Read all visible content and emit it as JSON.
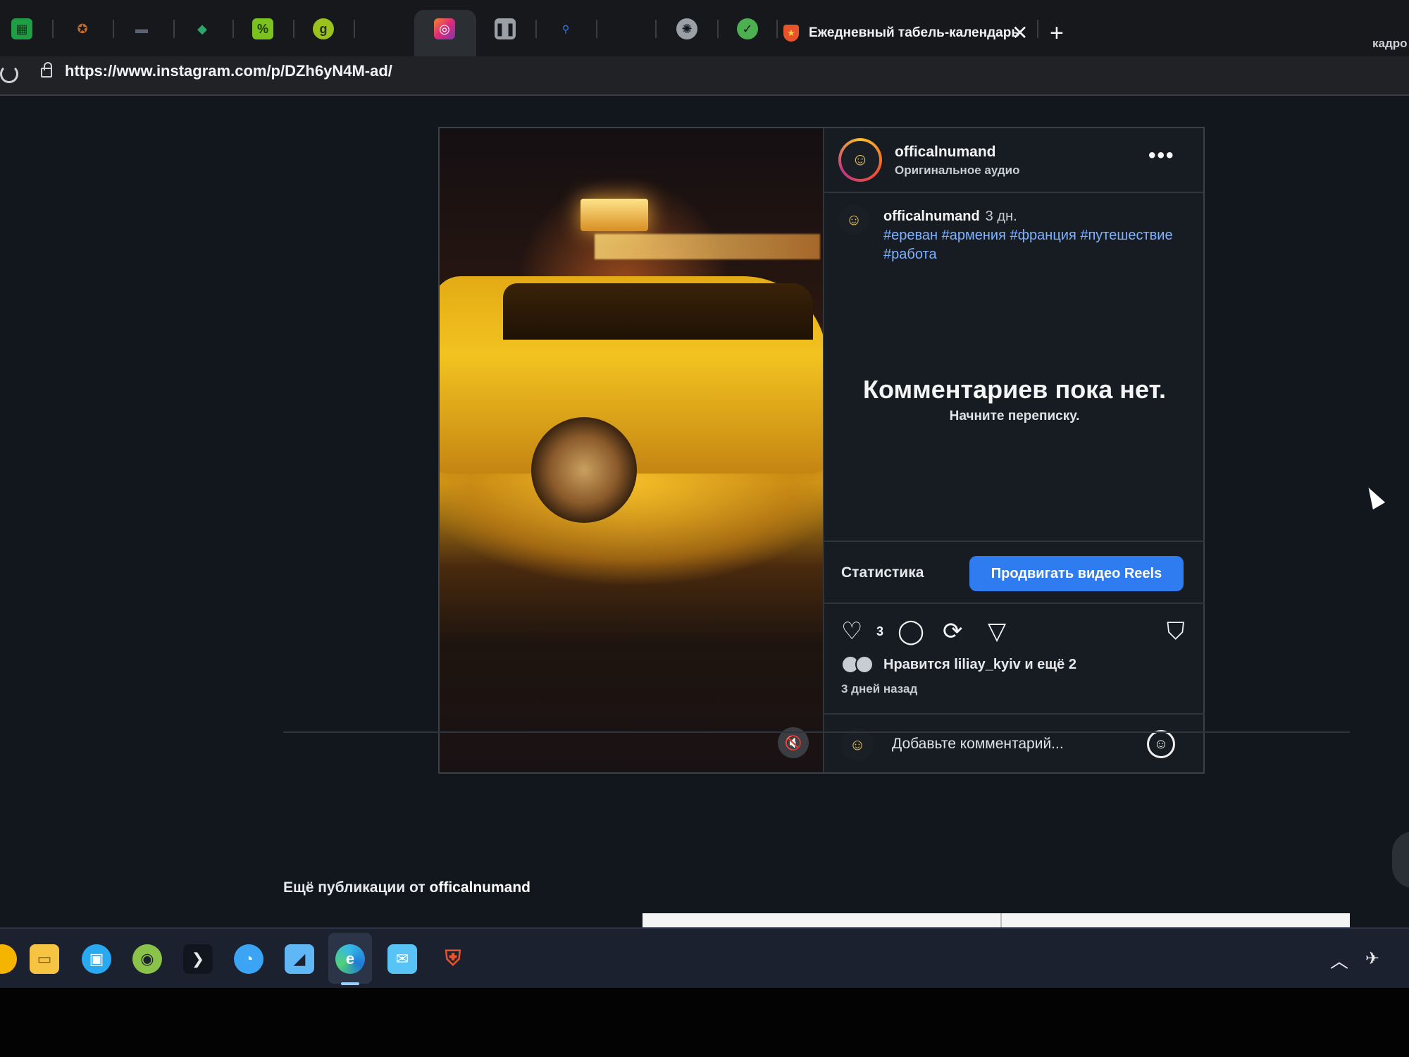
{
  "browser": {
    "tabs": [
      {
        "icon": "green-sheet-icon",
        "color": "#1f9e45"
      },
      {
        "icon": "shield-badge-icon",
        "color": "#c86b28"
      },
      {
        "icon": "folder-icon",
        "color": "#5a6470"
      },
      {
        "icon": "diamond-icon",
        "color": "#2ea56a"
      },
      {
        "icon": "grammarly-like-icon",
        "color": "#7cc21e"
      },
      {
        "icon": "g-circle-icon",
        "color": "#9ac21a"
      },
      {
        "icon": "instagram-icon",
        "color": "#e4405f"
      },
      {
        "icon": "pause-icon",
        "color": "#9aa0a6"
      },
      {
        "icon": "search-icon",
        "color": "#3d7bd8"
      },
      {
        "icon": "blank-tab-icon",
        "color": "#2b2e33"
      },
      {
        "icon": "chatgpt-icon",
        "color": "#9aa0a6"
      },
      {
        "icon": "clock-check-icon",
        "color": "#4caf50"
      }
    ],
    "active_tab_title": "Ежедневный табель-календарь",
    "close_label": "✕",
    "new_tab_label": "+",
    "right_label": "кадро",
    "url": "https://www.instagram.com/p/DZh6yN4M-ad/"
  },
  "post": {
    "username": "officalnumand",
    "audio": "Оригинальное аудио",
    "more_label": "•••",
    "caption_time": "3 дн.",
    "caption_tags": "#ереван #армения #франция #путешествие #работа",
    "empty_title": "Комментариев пока нет.",
    "empty_subtitle": "Начните переписку.",
    "stats_label": "Статистика",
    "promote_label": "Продвигать видео Reels",
    "like_count": "3",
    "likes_text": "Нравится liliay_kyiv и ещё 2",
    "time_ago": "3 дней назад",
    "comment_placeholder": "Добавьте комментарий...",
    "mute_icon": "muted-speaker-icon"
  },
  "footer": {
    "more_posts_prefix": "Ещё публикации от",
    "more_posts_user": "officalnumand"
  },
  "taskbar": {
    "icons": [
      {
        "name": "chrome-icon",
        "color": "#f4b400"
      },
      {
        "name": "file-explorer-icon",
        "color": "#f6c342"
      },
      {
        "name": "store-icon",
        "color": "#29a9f0"
      },
      {
        "name": "globe-icon",
        "color": "#8bc34a"
      },
      {
        "name": "terminal-icon",
        "color": "#e6e8eb"
      },
      {
        "name": "messenger-icon",
        "color": "#3ba4f5"
      },
      {
        "name": "remote-desktop-icon",
        "color": "#5fb8f5"
      },
      {
        "name": "edge-icon",
        "color": "#36b7e9"
      },
      {
        "name": "mail-icon",
        "color": "#58c4f5"
      },
      {
        "name": "vpn-shield-icon",
        "color": "#e8532a"
      }
    ]
  }
}
